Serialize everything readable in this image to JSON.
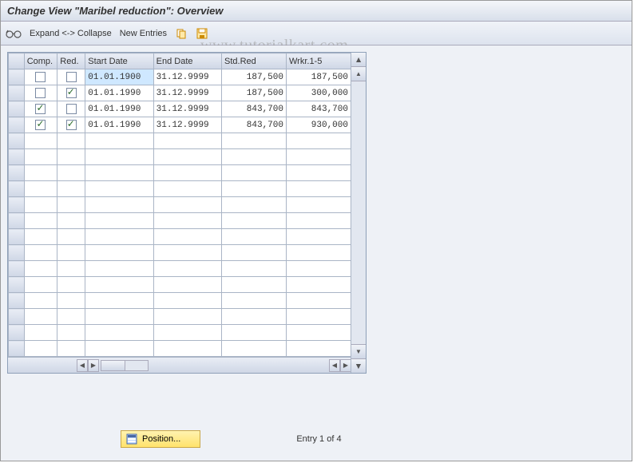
{
  "title": "Change View \"Maribel reduction\": Overview",
  "toolbar": {
    "expand_collapse": "Expand <-> Collapse",
    "new_entries": "New Entries"
  },
  "watermark": "www.tutorialkart.com",
  "columns": {
    "comp": "Comp.",
    "red": "Red.",
    "start": "Start Date",
    "end": "End Date",
    "stdred": "Std.Red",
    "wrkr": "Wrkr.1-5"
  },
  "rows": [
    {
      "comp": false,
      "red": false,
      "start": "01.01.1900",
      "end": "31.12.9999",
      "stdred": "187,500",
      "wrkr": "187,500",
      "highlight": true
    },
    {
      "comp": false,
      "red": true,
      "start": "01.01.1990",
      "end": "31.12.9999",
      "stdred": "187,500",
      "wrkr": "300,000"
    },
    {
      "comp": true,
      "red": false,
      "start": "01.01.1990",
      "end": "31.12.9999",
      "stdred": "843,700",
      "wrkr": "843,700"
    },
    {
      "comp": true,
      "red": true,
      "start": "01.01.1990",
      "end": "31.12.9999",
      "stdred": "843,700",
      "wrkr": "930,000"
    }
  ],
  "empty_row_count": 14,
  "position_button": "Position...",
  "entry_status": "Entry 1 of 4"
}
